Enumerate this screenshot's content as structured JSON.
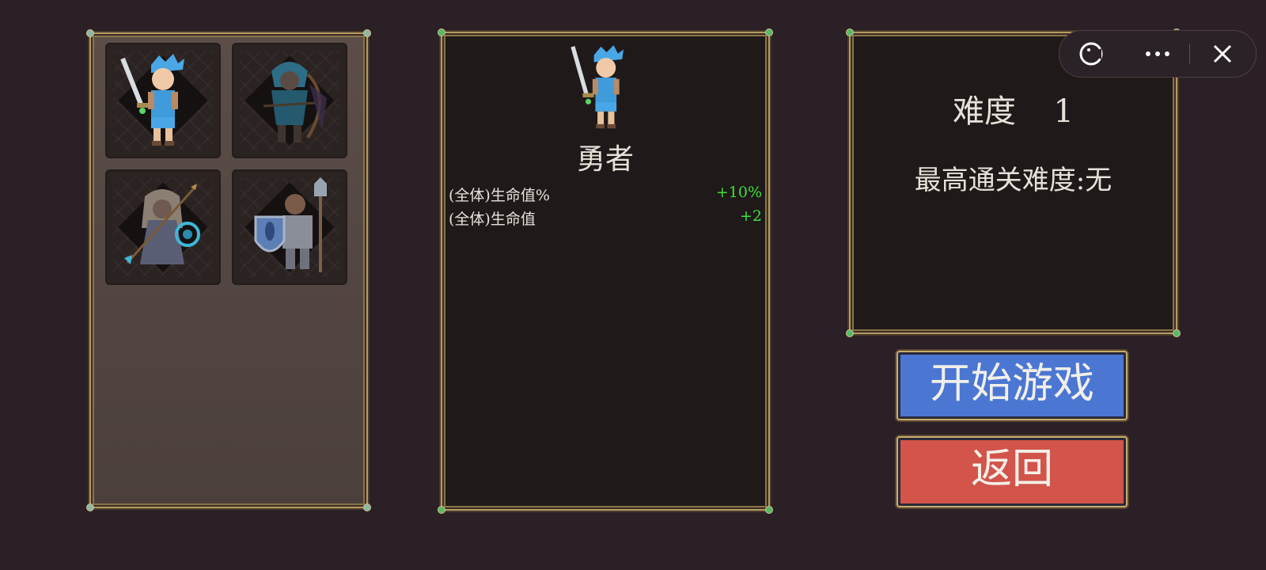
{
  "roster": {
    "heroes": [
      {
        "name": "brave-swordsman",
        "selected": true
      },
      {
        "name": "hooded-archer",
        "selected": false
      },
      {
        "name": "priestess-mage",
        "selected": false
      },
      {
        "name": "shield-knight",
        "selected": false
      }
    ]
  },
  "detail": {
    "hero_name": "勇者",
    "stats": [
      {
        "label": "(全体)生命值%",
        "value": "+10%"
      },
      {
        "label": "(全体)生命值",
        "value": "+2"
      }
    ]
  },
  "info": {
    "difficulty_label": "难度",
    "difficulty_value": "1",
    "best_clear": "最高通关难度:无"
  },
  "buttons": {
    "start": "开始游戏",
    "back": "返回"
  },
  "capsule": {
    "icons": [
      "game-icon",
      "more-icon",
      "close-icon"
    ]
  },
  "colors": {
    "background": "#2a2026",
    "start_button": "#4b77d3",
    "back_button": "#d2544b",
    "stat_value": "#3be03b"
  }
}
